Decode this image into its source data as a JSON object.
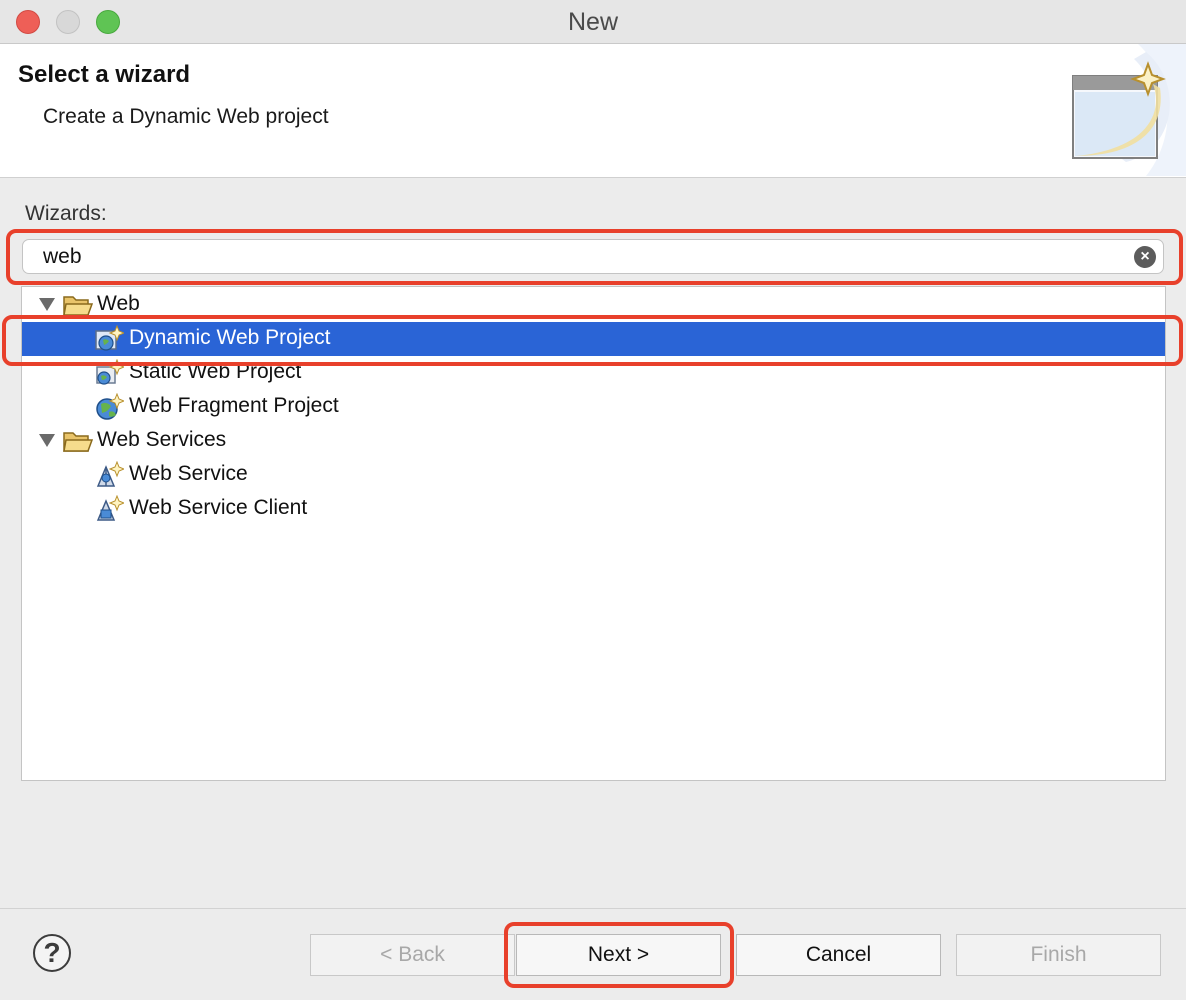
{
  "window": {
    "title": "New"
  },
  "header": {
    "title": "Select a wizard",
    "description": "Create a Dynamic Web project",
    "banner_icon": "wizard-banner-icon"
  },
  "wizards": {
    "label": "Wizards:",
    "filter_value": "web",
    "clear_icon": "clear-icon",
    "tree": [
      {
        "label": "Web",
        "level": 0,
        "expanded": true,
        "icon": "folder-icon"
      },
      {
        "label": "Dynamic Web Project",
        "level": 1,
        "selected": true,
        "icon": "dynamic-web-project-icon"
      },
      {
        "label": "Static Web Project",
        "level": 1,
        "icon": "static-web-project-icon"
      },
      {
        "label": "Web Fragment Project",
        "level": 1,
        "icon": "web-fragment-project-icon"
      },
      {
        "label": "Web Services",
        "level": 0,
        "expanded": true,
        "icon": "folder-icon"
      },
      {
        "label": "Web Service",
        "level": 1,
        "icon": "web-service-icon"
      },
      {
        "label": "Web Service Client",
        "level": 1,
        "icon": "web-service-client-icon"
      }
    ]
  },
  "buttons": {
    "help": "?",
    "back": "< Back",
    "next": "Next >",
    "cancel": "Cancel",
    "finish": "Finish"
  },
  "colors": {
    "selection": "#2a64d6",
    "annotation": "#e8402b"
  }
}
